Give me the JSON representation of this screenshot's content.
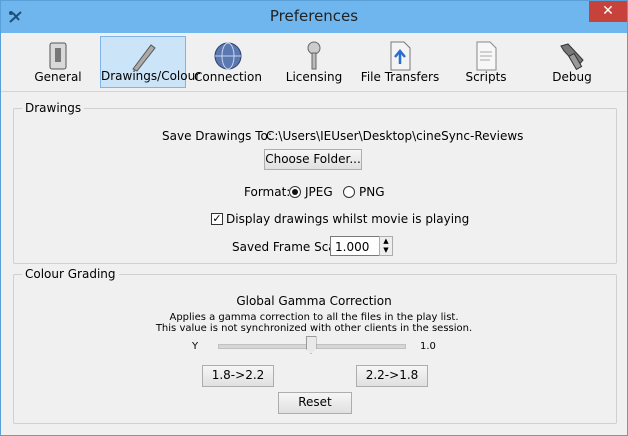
{
  "window": {
    "title": "Preferences",
    "close_label": "✕"
  },
  "toolbar": {
    "tabs": [
      {
        "label": "General",
        "icon": "switch-icon"
      },
      {
        "label": "Drawings/Colour",
        "icon": "pen-icon",
        "active": true
      },
      {
        "label": "Connection",
        "icon": "globe-icon"
      },
      {
        "label": "Licensing",
        "icon": "key-icon"
      },
      {
        "label": "File Transfers",
        "icon": "file-upload-icon"
      },
      {
        "label": "Scripts",
        "icon": "script-icon"
      },
      {
        "label": "Debug",
        "icon": "tools-icon"
      }
    ]
  },
  "drawings": {
    "group_label": "Drawings",
    "save_to_label": "Save Drawings To:",
    "save_to_path": "C:\\Users\\IEUser\\Desktop\\cineSync-Reviews",
    "choose_folder_label": "Choose Folder...",
    "format_label": "Format:",
    "format_options": [
      "JPEG",
      "PNG"
    ],
    "format_selected": "JPEG",
    "display_checkbox_label": "Display drawings whilst movie is playing",
    "display_checked": true,
    "scale_label": "Saved Frame Scale:",
    "scale_value": "1.000"
  },
  "colour_grading": {
    "group_label": "Colour Grading",
    "heading": "Global Gamma Correction",
    "desc_line1": "Applies a gamma correction to all the files in the play list.",
    "desc_line2": "This value is not synchronized with other clients in the session.",
    "slider_left_label": "Y",
    "slider_value_label": "1.0",
    "slider_fraction": 0.5,
    "btn_18_22": "1.8->2.2",
    "btn_22_18": "2.2->1.8",
    "reset_label": "Reset"
  }
}
